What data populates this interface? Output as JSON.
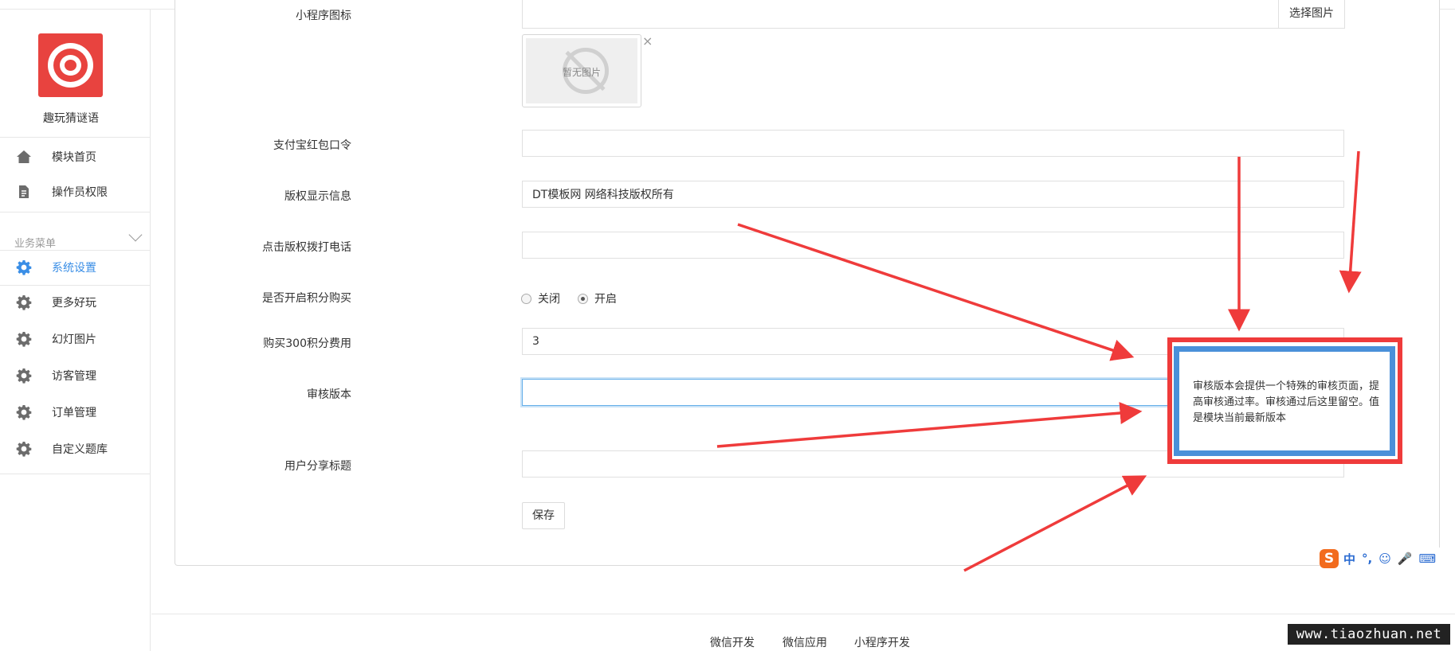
{
  "app": {
    "name": "趣玩猜谜语"
  },
  "sidebar": {
    "items": [
      {
        "label": "模块首页",
        "icon": "home-icon"
      },
      {
        "label": "操作员权限",
        "icon": "document-edit-icon"
      }
    ],
    "section_title": "业务菜单",
    "menu": [
      {
        "label": "系统设置",
        "icon": "gear-icon",
        "active": true
      },
      {
        "label": "更多好玩",
        "icon": "gear-icon"
      },
      {
        "label": "幻灯图片",
        "icon": "gear-icon"
      },
      {
        "label": "访客管理",
        "icon": "gear-icon"
      },
      {
        "label": "订单管理",
        "icon": "gear-icon"
      },
      {
        "label": "自定义题库",
        "icon": "gear-icon"
      }
    ]
  },
  "form": {
    "mini_icon": {
      "label": "小程序图标",
      "value": "",
      "pick_button": "选择图片",
      "placeholder_image_text": "暂无图片",
      "remove": "×"
    },
    "alipay_code": {
      "label": "支付宝红包口令",
      "value": ""
    },
    "copyright": {
      "label": "版权显示信息",
      "value": "DT模板网 网络科技版权所有"
    },
    "copyright_phone": {
      "label": "点击版权拨打电话",
      "value": ""
    },
    "points_purchase": {
      "label": "是否开启积分购买",
      "options": [
        "关闭",
        "开启"
      ],
      "selected": "开启"
    },
    "points_fee": {
      "label": "购买300积分费用",
      "value": "3"
    },
    "review_version": {
      "label": "审核版本",
      "value": ""
    },
    "share_title": {
      "label": "用户分享标题",
      "value": ""
    },
    "save_label": "保存"
  },
  "annotation": {
    "text": "审核版本会提供一个特殊的审核页面，提高审核通过率。审核通过后这里留空。值是模块当前最新版本"
  },
  "footer": {
    "links": [
      "微信开发",
      "微信应用",
      "小程序开发"
    ]
  },
  "ime_toolbar": {
    "logo": "S",
    "items": [
      "中",
      "°,",
      "☺",
      "🎤",
      "⌨"
    ]
  },
  "watermark": "www.tiaozhuan.net",
  "colors": {
    "accent": "#3a8ee6",
    "logo": "#e8433f",
    "annotation_red": "#ef3b3b",
    "annotation_blue": "#4a90d9"
  }
}
